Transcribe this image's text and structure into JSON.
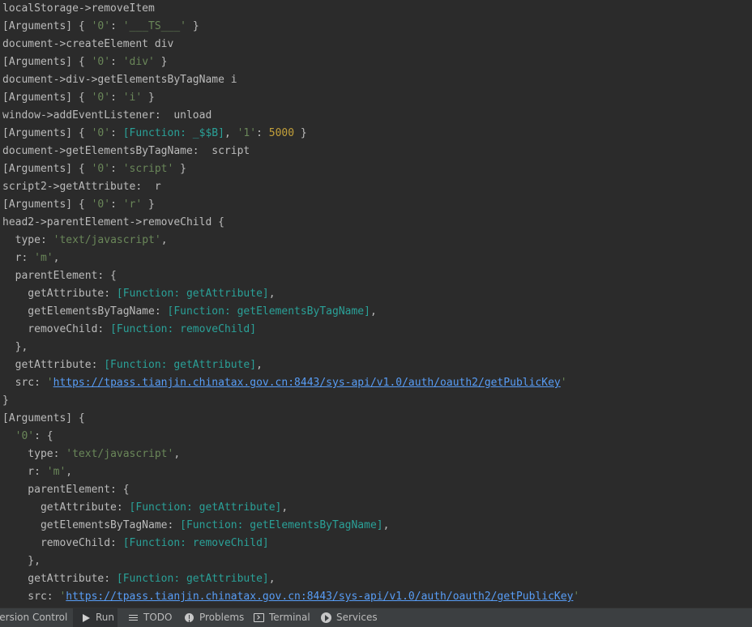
{
  "console": {
    "lines": [
      [
        {
          "t": "localStorage->removeItem",
          "c": "plain"
        }
      ],
      [
        {
          "t": "[Arguments] { ",
          "c": "plain"
        },
        {
          "t": "'0'",
          "c": "str"
        },
        {
          "t": ": ",
          "c": "plain"
        },
        {
          "t": "'___TS___'",
          "c": "str"
        },
        {
          "t": " }",
          "c": "plain"
        }
      ],
      [
        {
          "t": "document->createElement div",
          "c": "plain"
        }
      ],
      [
        {
          "t": "[Arguments] { ",
          "c": "plain"
        },
        {
          "t": "'0'",
          "c": "str"
        },
        {
          "t": ": ",
          "c": "plain"
        },
        {
          "t": "'div'",
          "c": "str"
        },
        {
          "t": " }",
          "c": "plain"
        }
      ],
      [
        {
          "t": "document->div->getElementsByTagName i",
          "c": "plain"
        }
      ],
      [
        {
          "t": "[Arguments] { ",
          "c": "plain"
        },
        {
          "t": "'0'",
          "c": "str"
        },
        {
          "t": ": ",
          "c": "plain"
        },
        {
          "t": "'i'",
          "c": "str"
        },
        {
          "t": " }",
          "c": "plain"
        }
      ],
      [
        {
          "t": "window->addEventListener:  unload",
          "c": "plain"
        }
      ],
      [
        {
          "t": "[Arguments] { ",
          "c": "plain"
        },
        {
          "t": "'0'",
          "c": "str"
        },
        {
          "t": ": ",
          "c": "plain"
        },
        {
          "t": "[Function: _$$B]",
          "c": "fn"
        },
        {
          "t": ", ",
          "c": "plain"
        },
        {
          "t": "'1'",
          "c": "str"
        },
        {
          "t": ": ",
          "c": "plain"
        },
        {
          "t": "5000",
          "c": "num"
        },
        {
          "t": " }",
          "c": "plain"
        }
      ],
      [
        {
          "t": "document->getElementsByTagName:  script",
          "c": "plain"
        }
      ],
      [
        {
          "t": "[Arguments] { ",
          "c": "plain"
        },
        {
          "t": "'0'",
          "c": "str"
        },
        {
          "t": ": ",
          "c": "plain"
        },
        {
          "t": "'script'",
          "c": "str"
        },
        {
          "t": " }",
          "c": "plain"
        }
      ],
      [
        {
          "t": "script2->getAttribute:  r",
          "c": "plain"
        }
      ],
      [
        {
          "t": "[Arguments] { ",
          "c": "plain"
        },
        {
          "t": "'0'",
          "c": "str"
        },
        {
          "t": ": ",
          "c": "plain"
        },
        {
          "t": "'r'",
          "c": "str"
        },
        {
          "t": " }",
          "c": "plain"
        }
      ],
      [
        {
          "t": "head2->parentElement->removeChild {",
          "c": "plain"
        }
      ],
      [
        {
          "t": "  type: ",
          "c": "plain"
        },
        {
          "t": "'text/javascript'",
          "c": "str"
        },
        {
          "t": ",",
          "c": "plain"
        }
      ],
      [
        {
          "t": "  r: ",
          "c": "plain"
        },
        {
          "t": "'m'",
          "c": "str"
        },
        {
          "t": ",",
          "c": "plain"
        }
      ],
      [
        {
          "t": "  parentElement: {",
          "c": "plain"
        }
      ],
      [
        {
          "t": "    getAttribute: ",
          "c": "plain"
        },
        {
          "t": "[Function: getAttribute]",
          "c": "fn"
        },
        {
          "t": ",",
          "c": "plain"
        }
      ],
      [
        {
          "t": "    getElementsByTagName: ",
          "c": "plain"
        },
        {
          "t": "[Function: getElementsByTagName]",
          "c": "fn"
        },
        {
          "t": ",",
          "c": "plain"
        }
      ],
      [
        {
          "t": "    removeChild: ",
          "c": "plain"
        },
        {
          "t": "[Function: removeChild]",
          "c": "fn"
        }
      ],
      [
        {
          "t": "  },",
          "c": "plain"
        }
      ],
      [
        {
          "t": "  getAttribute: ",
          "c": "plain"
        },
        {
          "t": "[Function: getAttribute]",
          "c": "fn"
        },
        {
          "t": ",",
          "c": "plain"
        }
      ],
      [
        {
          "t": "  src: ",
          "c": "plain"
        },
        {
          "t": "'",
          "c": "str"
        },
        {
          "t": "https://tpass.tianjin.chinatax.gov.cn:8443/sys-api/v1.0/auth/oauth2/getPublicKey",
          "c": "link"
        },
        {
          "t": "'",
          "c": "str"
        }
      ],
      [
        {
          "t": "}",
          "c": "plain"
        }
      ],
      [
        {
          "t": "[Arguments] {",
          "c": "plain"
        }
      ],
      [
        {
          "t": "  ",
          "c": "plain"
        },
        {
          "t": "'0'",
          "c": "str"
        },
        {
          "t": ": {",
          "c": "plain"
        }
      ],
      [
        {
          "t": "    type: ",
          "c": "plain"
        },
        {
          "t": "'text/javascript'",
          "c": "str"
        },
        {
          "t": ",",
          "c": "plain"
        }
      ],
      [
        {
          "t": "    r: ",
          "c": "plain"
        },
        {
          "t": "'m'",
          "c": "str"
        },
        {
          "t": ",",
          "c": "plain"
        }
      ],
      [
        {
          "t": "    parentElement: {",
          "c": "plain"
        }
      ],
      [
        {
          "t": "      getAttribute: ",
          "c": "plain"
        },
        {
          "t": "[Function: getAttribute]",
          "c": "fn"
        },
        {
          "t": ",",
          "c": "plain"
        }
      ],
      [
        {
          "t": "      getElementsByTagName: ",
          "c": "plain"
        },
        {
          "t": "[Function: getElementsByTagName]",
          "c": "fn"
        },
        {
          "t": ",",
          "c": "plain"
        }
      ],
      [
        {
          "t": "      removeChild: ",
          "c": "plain"
        },
        {
          "t": "[Function: removeChild]",
          "c": "fn"
        }
      ],
      [
        {
          "t": "    },",
          "c": "plain"
        }
      ],
      [
        {
          "t": "    getAttribute: ",
          "c": "plain"
        },
        {
          "t": "[Function: getAttribute]",
          "c": "fn"
        },
        {
          "t": ",",
          "c": "plain"
        }
      ],
      [
        {
          "t": "    src: ",
          "c": "plain"
        },
        {
          "t": "'",
          "c": "str"
        },
        {
          "t": "https://tpass.tianjin.chinatax.gov.cn:8443/sys-api/v1.0/auth/oauth2/getPublicKey",
          "c": "link"
        },
        {
          "t": "'",
          "c": "str"
        }
      ]
    ]
  },
  "toolbar": {
    "version_control_label": "Version Control",
    "run_label": "Run",
    "todo_label": "TODO",
    "problems_label": "Problems",
    "terminal_label": "Terminal",
    "services_label": "Services"
  }
}
